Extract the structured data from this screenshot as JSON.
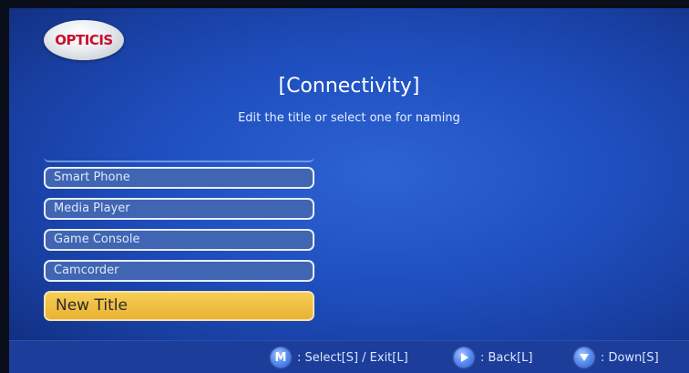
{
  "logo": {
    "text": "OPTICIS"
  },
  "header": {
    "title": "[Connectivity]",
    "subtitle": "Edit the title or select one for naming"
  },
  "menu": {
    "items": [
      {
        "label": "Smart Phone"
      },
      {
        "label": "Media Player"
      },
      {
        "label": "Game Console"
      },
      {
        "label": "Camcorder"
      },
      {
        "label": "New Title",
        "selected": true
      }
    ]
  },
  "hints": {
    "m_icon": "M",
    "select_exit": ": Select[S] / Exit[L]",
    "back": ": Back[L]",
    "down": ": Down[S]"
  },
  "colors": {
    "background": "#1f4fbf",
    "item_bg": "#3f65b3",
    "selected_bg": "#f0be40",
    "bottom_bar": "#1d3d9a"
  }
}
